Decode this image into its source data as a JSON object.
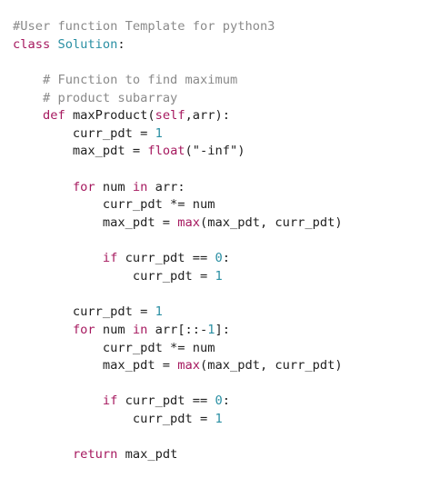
{
  "editor": {
    "lines": [
      [
        {
          "t": "#User function Template for python3",
          "c": "comment"
        }
      ],
      [
        {
          "t": "class",
          "c": "keyword"
        },
        {
          "t": " ",
          "c": "plain"
        },
        {
          "t": "Solution",
          "c": "class"
        },
        {
          "t": ":",
          "c": "plain"
        }
      ],
      [],
      [
        {
          "t": "    ",
          "c": "plain"
        },
        {
          "t": "# Function to find maximum",
          "c": "comment"
        }
      ],
      [
        {
          "t": "    ",
          "c": "plain"
        },
        {
          "t": "# product subarray",
          "c": "comment"
        }
      ],
      [
        {
          "t": "    ",
          "c": "plain"
        },
        {
          "t": "def",
          "c": "keyword"
        },
        {
          "t": " maxProduct(",
          "c": "plain"
        },
        {
          "t": "self",
          "c": "builtin"
        },
        {
          "t": ",arr):",
          "c": "plain"
        }
      ],
      [
        {
          "t": "        curr_pdt = ",
          "c": "plain"
        },
        {
          "t": "1",
          "c": "number"
        }
      ],
      [
        {
          "t": "        max_pdt = ",
          "c": "plain"
        },
        {
          "t": "float",
          "c": "builtin"
        },
        {
          "t": "(",
          "c": "plain"
        },
        {
          "t": "\"-inf\"",
          "c": "string"
        },
        {
          "t": ")",
          "c": "plain"
        }
      ],
      [],
      [
        {
          "t": "        ",
          "c": "plain"
        },
        {
          "t": "for",
          "c": "keyword"
        },
        {
          "t": " num ",
          "c": "plain"
        },
        {
          "t": "in",
          "c": "keyword"
        },
        {
          "t": " arr:",
          "c": "plain"
        }
      ],
      [
        {
          "t": "            curr_pdt *= num",
          "c": "plain"
        }
      ],
      [
        {
          "t": "            max_pdt = ",
          "c": "plain"
        },
        {
          "t": "max",
          "c": "builtin"
        },
        {
          "t": "(max_pdt, curr_pdt)",
          "c": "plain"
        }
      ],
      [],
      [
        {
          "t": "            ",
          "c": "plain"
        },
        {
          "t": "if",
          "c": "keyword"
        },
        {
          "t": " curr_pdt == ",
          "c": "plain"
        },
        {
          "t": "0",
          "c": "number"
        },
        {
          "t": ":",
          "c": "plain"
        }
      ],
      [
        {
          "t": "                curr_pdt = ",
          "c": "plain"
        },
        {
          "t": "1",
          "c": "number"
        }
      ],
      [],
      [
        {
          "t": "        curr_pdt = ",
          "c": "plain"
        },
        {
          "t": "1",
          "c": "number"
        }
      ],
      [
        {
          "t": "        ",
          "c": "plain"
        },
        {
          "t": "for",
          "c": "keyword"
        },
        {
          "t": " num ",
          "c": "plain"
        },
        {
          "t": "in",
          "c": "keyword"
        },
        {
          "t": " arr[::-",
          "c": "plain"
        },
        {
          "t": "1",
          "c": "number"
        },
        {
          "t": "]:",
          "c": "plain"
        }
      ],
      [
        {
          "t": "            curr_pdt *= num",
          "c": "plain"
        }
      ],
      [
        {
          "t": "            max_pdt = ",
          "c": "plain"
        },
        {
          "t": "max",
          "c": "builtin"
        },
        {
          "t": "(max_pdt, curr_pdt)",
          "c": "plain"
        }
      ],
      [],
      [
        {
          "t": "            ",
          "c": "plain"
        },
        {
          "t": "if",
          "c": "keyword"
        },
        {
          "t": " curr_pdt == ",
          "c": "plain"
        },
        {
          "t": "0",
          "c": "number"
        },
        {
          "t": ":",
          "c": "plain"
        }
      ],
      [
        {
          "t": "                curr_pdt = ",
          "c": "plain"
        },
        {
          "t": "1",
          "c": "number"
        }
      ],
      [],
      [
        {
          "t": "        ",
          "c": "plain"
        },
        {
          "t": "return",
          "c": "keyword"
        },
        {
          "t": " max_pdt",
          "c": "plain"
        }
      ]
    ]
  },
  "colors": {
    "background": "#ffffff",
    "comment": "#8a8a8a",
    "keyword": "#a6195f",
    "class": "#2a8fa3",
    "number": "#2a8fa3",
    "text": "#1f1f1f"
  }
}
